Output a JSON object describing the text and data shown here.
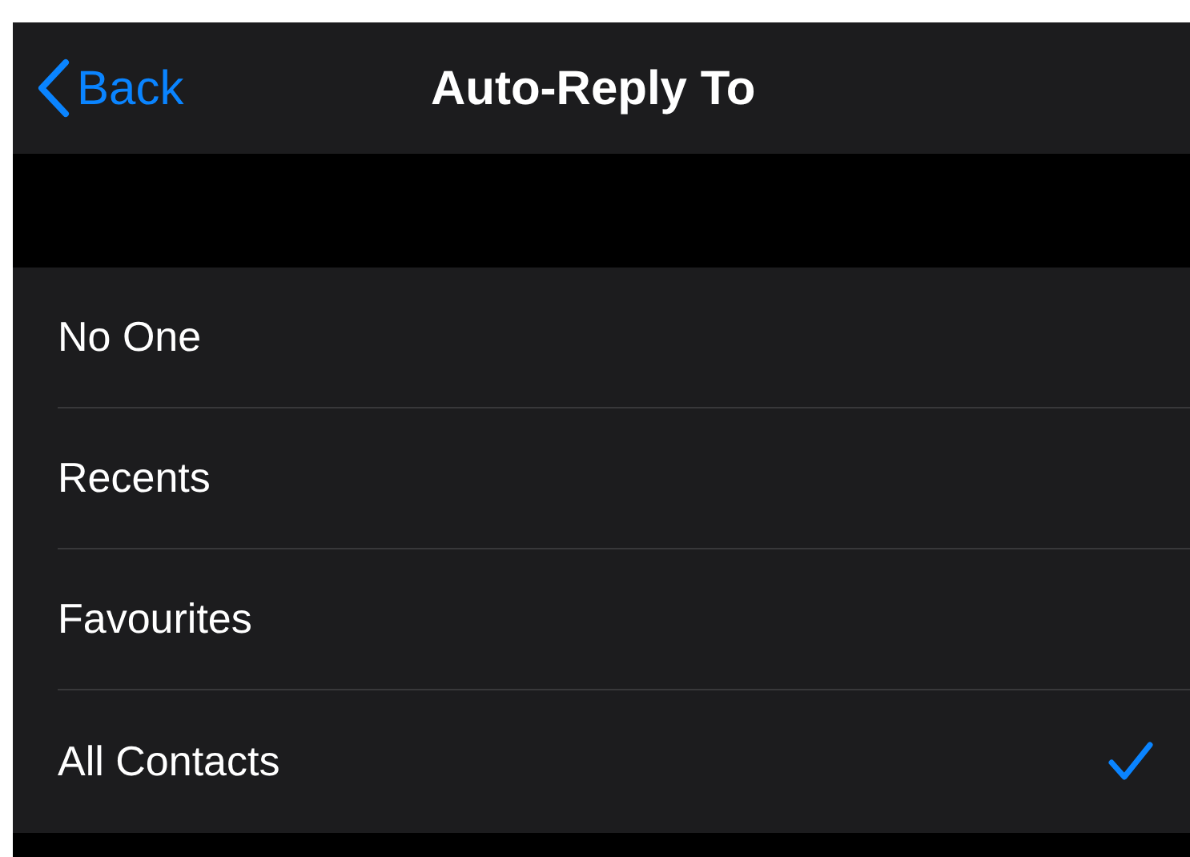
{
  "nav_bar": {
    "back_label": "Back",
    "title": "Auto-Reply To"
  },
  "options": [
    {
      "label": "No One",
      "selected": false
    },
    {
      "label": "Recents",
      "selected": false
    },
    {
      "label": "Favourites",
      "selected": false
    },
    {
      "label": "All Contacts",
      "selected": true
    }
  ]
}
